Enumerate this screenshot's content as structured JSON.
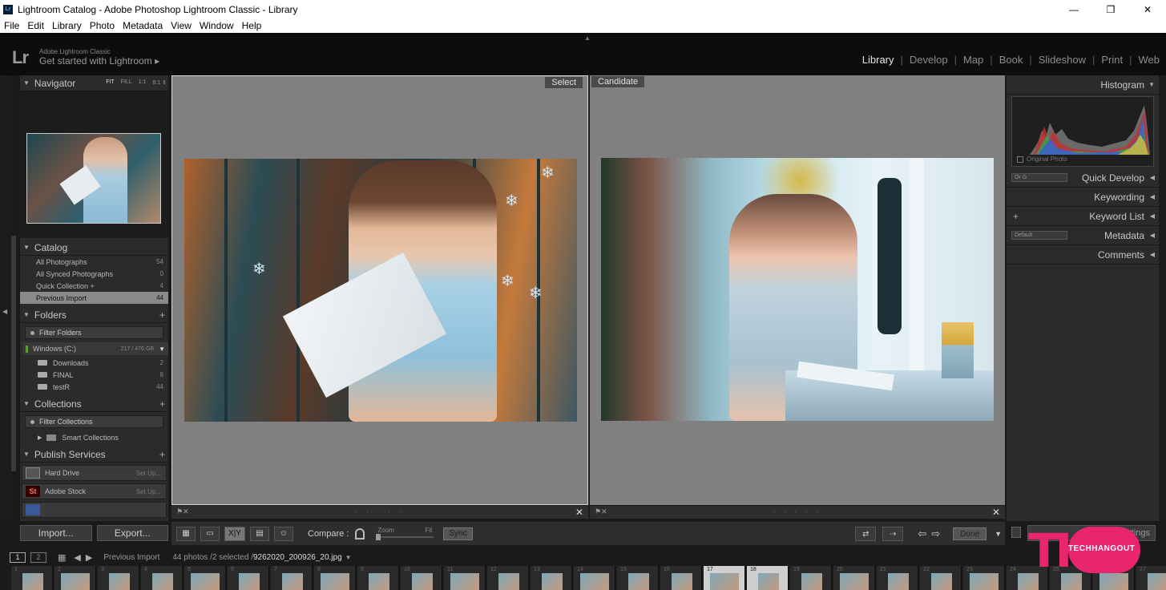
{
  "window": {
    "title": "Lightroom Catalog - Adobe Photoshop Lightroom Classic - Library",
    "app_icon": "Lr",
    "controls": [
      "—",
      "❐",
      "✕"
    ]
  },
  "menu": [
    "File",
    "Edit",
    "Library",
    "Photo",
    "Metadata",
    "View",
    "Window",
    "Help"
  ],
  "identity": {
    "logo": "Lr",
    "product": "Adobe Lightroom Classic",
    "tagline": "Get started with Lightroom ▸"
  },
  "modules": {
    "items": [
      "Library",
      "Develop",
      "Map",
      "Book",
      "Slideshow",
      "Print",
      "Web"
    ],
    "active": "Library"
  },
  "navigator": {
    "title": "Navigator",
    "options": [
      "FIT",
      "FILL",
      "1:1",
      "8:1 ⇕"
    ]
  },
  "catalog": {
    "title": "Catalog",
    "items": [
      {
        "label": "All Photographs",
        "count": "54"
      },
      {
        "label": "All Synced Photographs",
        "count": "0"
      },
      {
        "label": "Quick Collection +",
        "count": "4"
      },
      {
        "label": "Previous Import",
        "count": "44"
      }
    ]
  },
  "folders": {
    "title": "Folders",
    "filter": "Filter Folders",
    "volume": {
      "name": "Windows (C:)",
      "size": "217 / 476 GB"
    },
    "items": [
      {
        "label": "Downloads",
        "count": "2"
      },
      {
        "label": "FINAL",
        "count": "8"
      },
      {
        "label": "testR",
        "count": "44"
      }
    ]
  },
  "collections": {
    "title": "Collections",
    "filter": "Filter Collections",
    "smart": "Smart Collections"
  },
  "publish": {
    "title": "Publish Services",
    "items": [
      {
        "label": "Hard Drive",
        "action": "Set Up..."
      },
      {
        "label": "Adobe Stock",
        "action": "Set Up..."
      }
    ]
  },
  "left_buttons": {
    "import": "Import...",
    "export": "Export..."
  },
  "compare": {
    "select_tag": "Select",
    "candidate_tag": "Candidate"
  },
  "toolbar": {
    "compare_label": "Compare :",
    "zoom_label": "Zoom",
    "fit_label": "Fit",
    "sync": "Sync",
    "done": "Done",
    "xy": "X|Y"
  },
  "right_panel": {
    "histogram": "Histogram",
    "original_photo": "Original Photo",
    "quick_develop": "Quick Develop",
    "quick_develop_select": "Or G",
    "keywording": "Keywording",
    "keyword_list": "Keyword List",
    "metadata": "Metadata",
    "metadata_select": "Default",
    "comments": "Comments",
    "sync_settings": "Settings"
  },
  "filmbar": {
    "screen1": "1",
    "screen2": "2",
    "source": "Previous Import",
    "count": "44 photos /2 selected /",
    "filename": "9262020_200926_20.jpg"
  },
  "filmstrip": {
    "numbers": [
      "1",
      "2",
      "3",
      "4",
      "5",
      "6",
      "7",
      "8",
      "9",
      "10",
      "11",
      "12",
      "13",
      "14",
      "15",
      "16",
      "17",
      "18",
      "19",
      "20",
      "21",
      "22",
      "23",
      "24",
      "25",
      "26",
      "27"
    ],
    "selected": [
      "17",
      "18"
    ]
  },
  "watermark": {
    "text": "TECHHANGOUT"
  },
  "colors": {
    "accent_watermark": "#e8256d",
    "lightroom_blue": "#31a8ff"
  }
}
